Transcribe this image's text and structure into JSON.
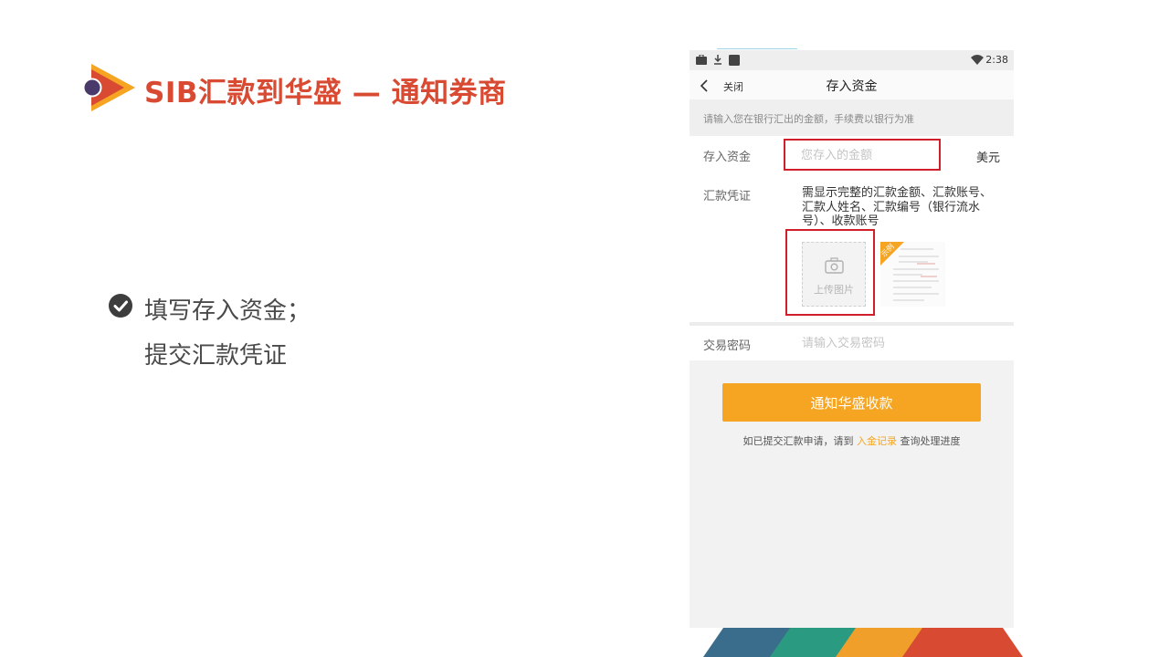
{
  "slide": {
    "title": "SIB汇款到华盛 — 通知券商",
    "bullets": [
      "填写存入资金；",
      "提交汇款凭证"
    ],
    "accent_color": "#d94a32"
  },
  "phone": {
    "status_bar": {
      "time": "2:38",
      "icons": [
        "briefcase-icon",
        "download-icon",
        "square-icon",
        "wifi-icon"
      ]
    },
    "nav": {
      "back_label": "关闭",
      "title": "存入资金"
    },
    "hint": "请输入您在银行汇出的金额，手续费以银行为准",
    "form": {
      "amount_label": "存入资金",
      "amount_placeholder": "您存入的金额",
      "currency_unit": "美元",
      "voucher_label": "汇款凭证",
      "voucher_description": "需显示完整的汇款金额、汇款账号、汇款人姓名、汇款编号（银行流水号）、收款账号",
      "upload_label": "上传图片",
      "sample_badge": "示例",
      "password_label": "交易密码",
      "password_placeholder": "请输入交易密码"
    },
    "submit_button": "通知华盛收款",
    "footer": {
      "prefix": "如已提交汇款申请，请到 ",
      "link": "入金记录",
      "suffix": " 查询处理进度"
    },
    "button_color": "#f5a522",
    "highlight_color": "#d01f2a"
  }
}
